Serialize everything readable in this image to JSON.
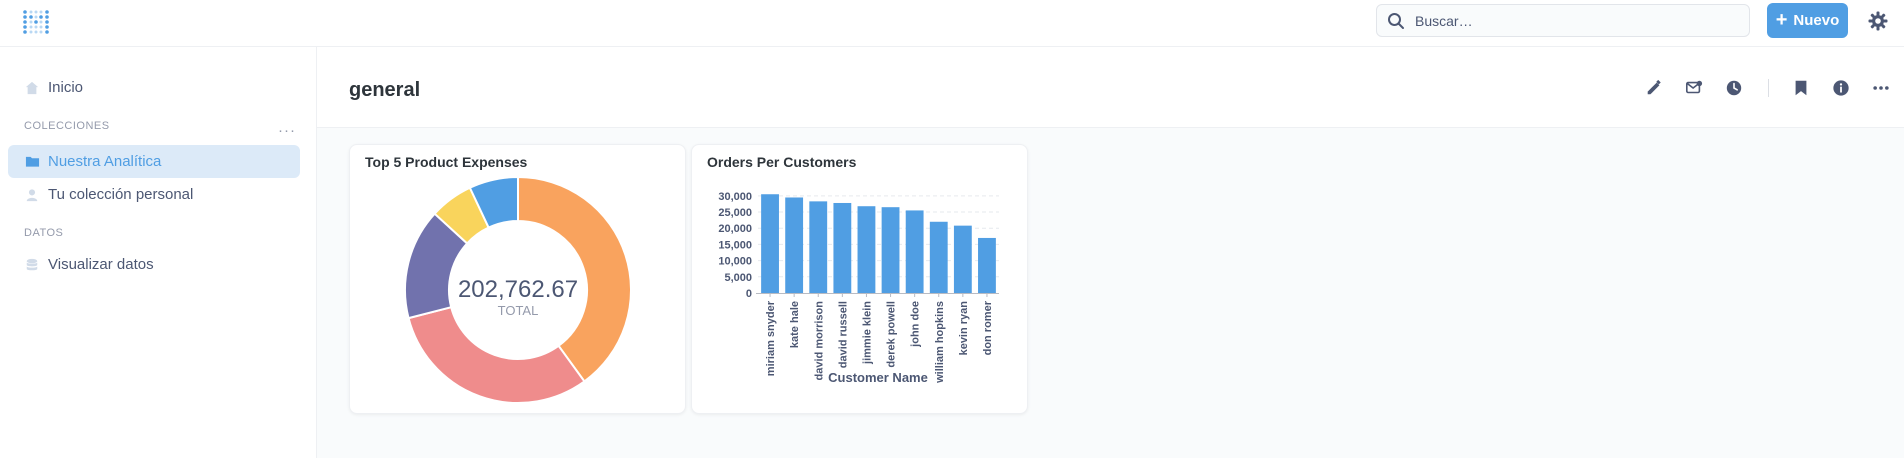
{
  "topbar": {
    "search_placeholder": "Buscar…",
    "new_button_label": "Nuevo",
    "accent_color": "#509ee3"
  },
  "sidebar": {
    "home_label": "Inicio",
    "collections_section": "COLECCIONES",
    "collections_more": "···",
    "collections": [
      {
        "label": "Nuestra Analítica",
        "icon": "folder-icon",
        "active": true
      },
      {
        "label": "Tu colección personal",
        "icon": "person-icon",
        "active": false
      }
    ],
    "data_section": "DATOS",
    "data_items": [
      {
        "label": "Visualizar datos",
        "icon": "database-icon"
      }
    ]
  },
  "dashboard": {
    "title": "general",
    "actions": [
      "edit-icon",
      "subscription-icon",
      "history-icon",
      "bookmark-icon",
      "info-icon",
      "more-icon"
    ]
  },
  "cards": [
    {
      "title": "Top 5 Product Expenses",
      "chart_data": {
        "type": "pie",
        "donut": true,
        "center_value": "202,762.67",
        "center_label": "TOTAL",
        "slices": [
          {
            "value": 0.4,
            "color": "#f9a35e"
          },
          {
            "value": 0.31,
            "color": "#ef8c8c"
          },
          {
            "value": 0.158,
            "color": "#7172ad"
          },
          {
            "value": 0.062,
            "color": "#f9d45c"
          },
          {
            "value": 0.07,
            "color": "#509ee3"
          }
        ]
      }
    },
    {
      "title": "Orders Per Customers",
      "chart_data": {
        "type": "bar",
        "categories": [
          "miriam snyder",
          "kate hale",
          "david morrison",
          "david russell",
          "jimmie klein",
          "derek powell",
          "john doe",
          "william hopkins",
          "kevin ryan",
          "don romer"
        ],
        "values": [
          30500,
          29500,
          28300,
          27800,
          26800,
          26500,
          25500,
          22000,
          20800,
          17000
        ],
        "yticks": [
          "0",
          "5,000",
          "10,000",
          "15,000",
          "20,000",
          "25,000",
          "30,000"
        ],
        "ylim": [
          0,
          30000
        ],
        "xlabel": "Customer Name",
        "ylabel": "",
        "color": "#509ee3"
      }
    }
  ]
}
